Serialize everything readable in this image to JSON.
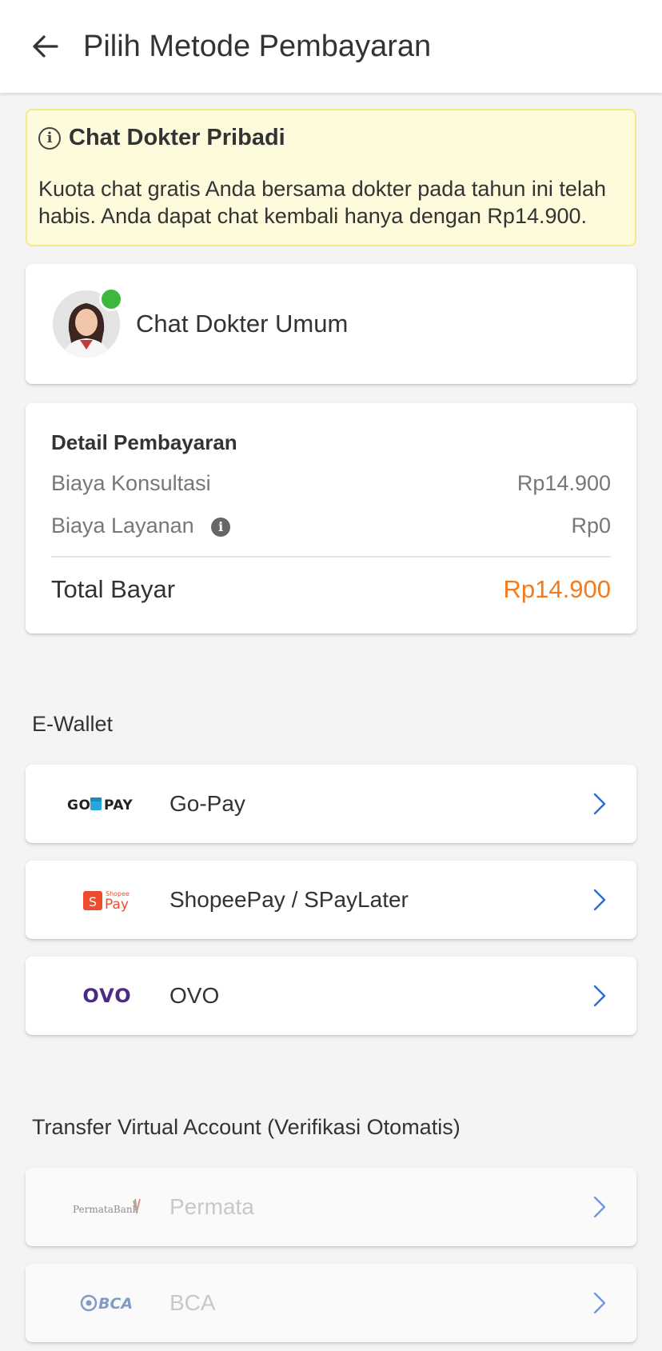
{
  "header": {
    "title": "Pilih Metode Pembayaran"
  },
  "info": {
    "title": "Chat Dokter Pribadi",
    "text": "Kuota chat gratis Anda bersama dokter pada tahun ini telah habis. Anda dapat chat kembali hanya dengan Rp14.900."
  },
  "doctor": {
    "name": "Chat Dokter Umum"
  },
  "payment": {
    "title": "Detail Pembayaran",
    "rows": [
      {
        "label": "Biaya Konsultasi",
        "value": "Rp14.900"
      },
      {
        "label": "Biaya Layanan",
        "value": "Rp0"
      }
    ],
    "total_label": "Total Bayar",
    "total_value": "Rp14.900"
  },
  "ewallet": {
    "title": "E-Wallet",
    "methods": [
      {
        "label": "Go-Pay",
        "logo": "gopay-logo"
      },
      {
        "label": "ShopeePay / SPayLater",
        "logo": "shopeepay-logo",
        "logo_text": "Shopee Pay"
      },
      {
        "label": "OVO",
        "logo": "ovo-logo",
        "logo_text": "OVO"
      }
    ]
  },
  "virtual_account": {
    "title": "Transfer Virtual Account (Verifikasi Otomatis)",
    "methods": [
      {
        "label": "Permata",
        "logo": "permata-logo",
        "logo_text": "PermataBank",
        "enabled": false
      },
      {
        "label": "BCA",
        "logo": "bca-logo",
        "logo_text": "BCA",
        "enabled": false
      }
    ]
  },
  "colors": {
    "accent_orange": "#f37b1d",
    "chevron_blue": "#2e6bd6",
    "online_green": "#3cb93c",
    "info_bg": "#fdfbdc",
    "ovo_purple": "#4c2a86",
    "shopee_orange": "#ee4d2d"
  }
}
